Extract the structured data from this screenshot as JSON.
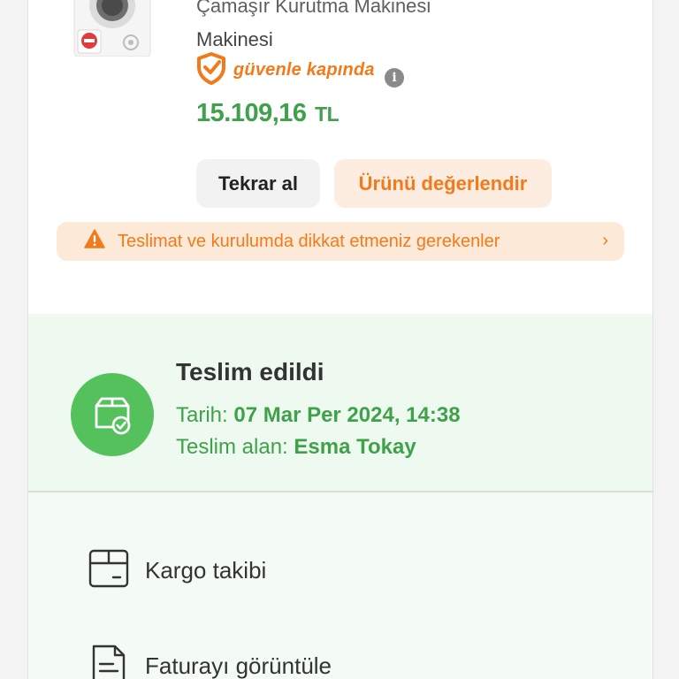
{
  "product": {
    "title_line1": "Çamaşır Kurutma Makinesi",
    "title_line2": "Makinesi",
    "brand_badge": "güvenle kapında",
    "price_value": "15.109,16",
    "price_currency": "TL"
  },
  "actions": {
    "buy_again_label": "Tekrar al",
    "rate_product_label": "Ürünü değerlendir"
  },
  "warning": {
    "label": "Teslimat ve kurulumda dikkat etmeniz gerekenler"
  },
  "delivery": {
    "status": "Teslim edildi",
    "date_label": "Tarih:",
    "date_value": "07 Mar Per 2024, 14:38",
    "receiver_label": "Teslim alan:",
    "receiver_value": "Esma Tokay"
  },
  "menu": {
    "cargo_tracking": "Kargo takibi",
    "view_invoice": "Faturayı görüntüle"
  },
  "colors": {
    "brand_orange": "#f27a1a",
    "success_green": "#54c15c",
    "price_green": "#3fa14a"
  },
  "icons": {
    "brand": "shield-check-icon",
    "info": "info-icon",
    "warning": "warning-triangle-icon",
    "chevron": "chevron-right-icon",
    "delivered": "box-check-icon",
    "cargo": "package-icon",
    "invoice": "document-icon"
  }
}
